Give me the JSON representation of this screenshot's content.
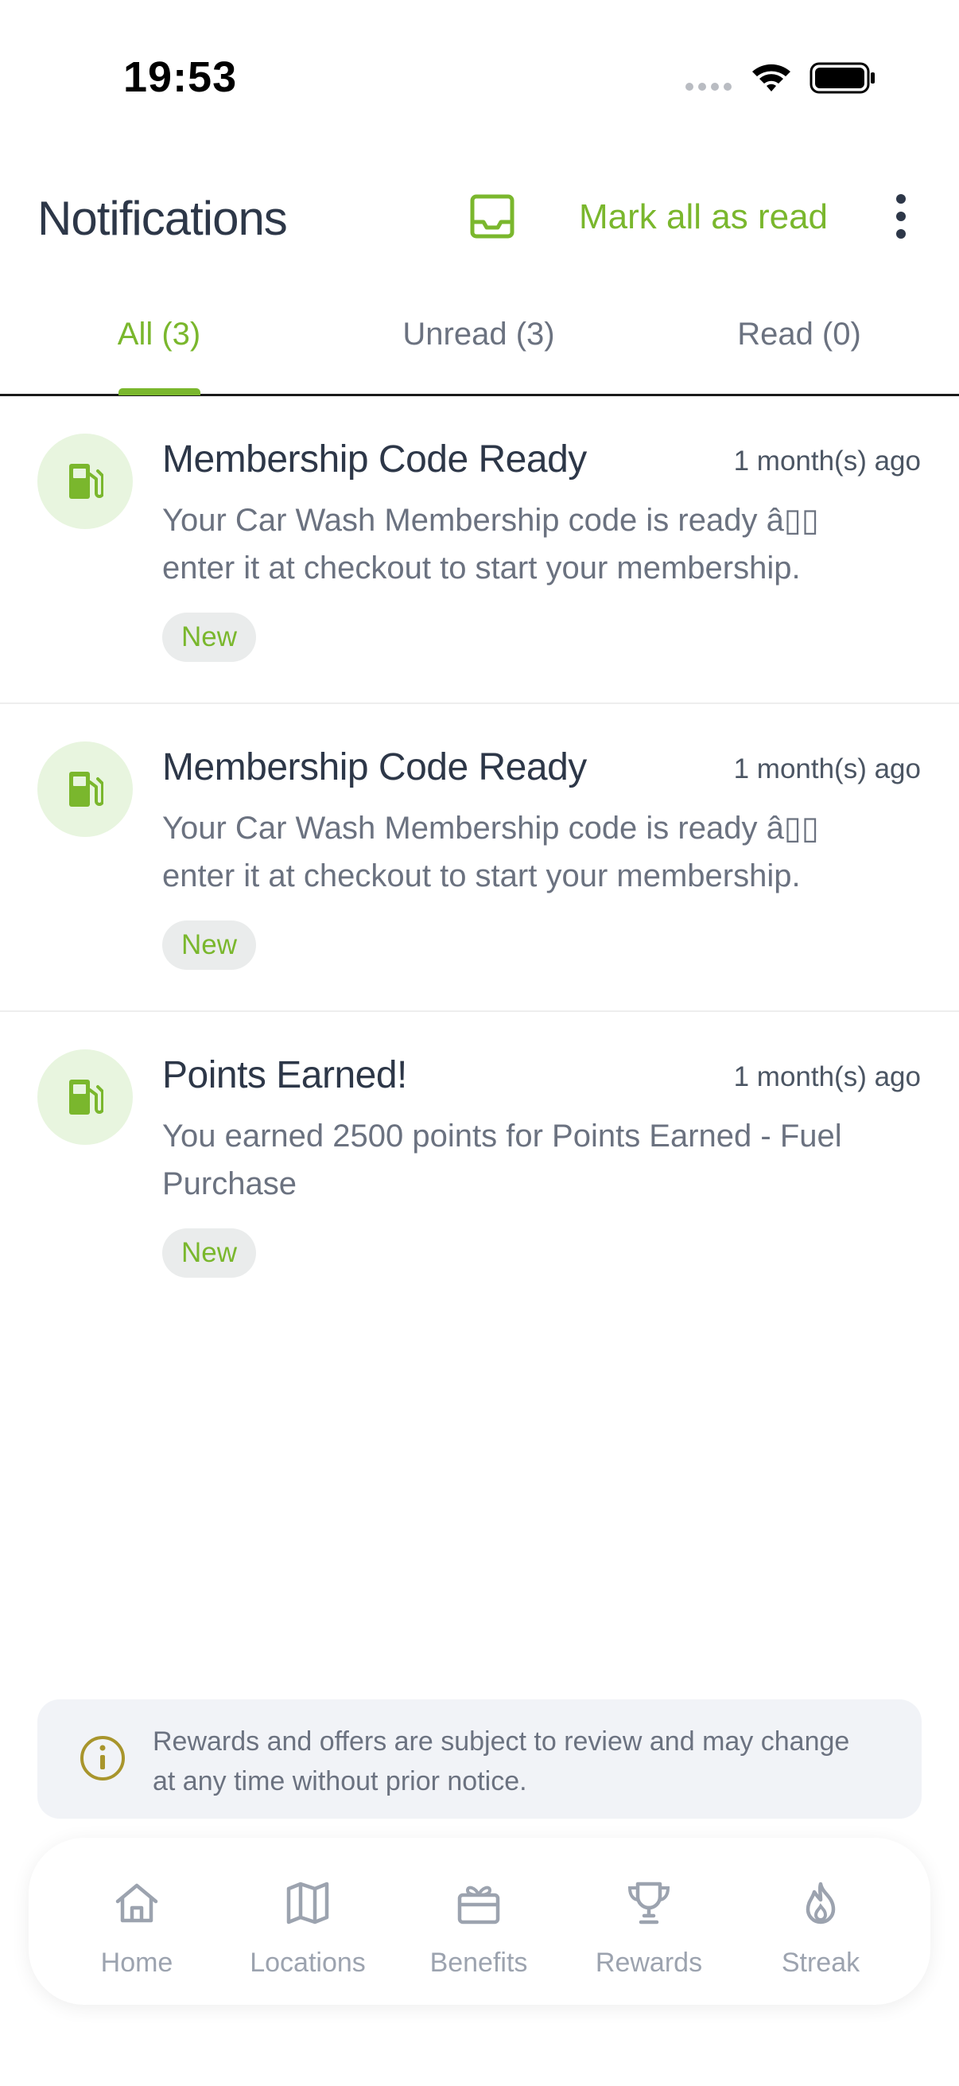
{
  "status_bar": {
    "time": "19:53"
  },
  "header": {
    "title": "Notifications",
    "inbox_icon": "inbox-icon",
    "mark_all_label": "Mark all as read",
    "more_icon": "more-vertical-icon"
  },
  "tabs": [
    {
      "label": "All (3)",
      "active": true
    },
    {
      "label": "Unread (3)",
      "active": false
    },
    {
      "label": "Read (0)",
      "active": false
    }
  ],
  "notifications": [
    {
      "icon": "fuel-pump-icon",
      "title": "Membership Code Ready",
      "time": "1 month(s) ago",
      "body": "Your Car Wash Membership code is ready â▯▯ enter it at checkout to start your membership.",
      "badge": "New"
    },
    {
      "icon": "fuel-pump-icon",
      "title": "Membership Code Ready",
      "time": "1 month(s) ago",
      "body": "Your Car Wash Membership code is ready â▯▯ enter it at checkout to start your membership.",
      "badge": "New"
    },
    {
      "icon": "fuel-pump-icon",
      "title": "Points Earned!",
      "time": "1 month(s) ago",
      "body": "You earned 2500 points for Points Earned - Fuel Purchase",
      "badge": "New"
    }
  ],
  "disclaimer": {
    "icon": "info-icon",
    "text": "Rewards and offers are subject to review and may change at any time without prior notice."
  },
  "bottom_nav": [
    {
      "label": "Home",
      "icon": "home-icon"
    },
    {
      "label": "Locations",
      "icon": "map-icon"
    },
    {
      "label": "Benefits",
      "icon": "gift-icon"
    },
    {
      "label": "Rewards",
      "icon": "trophy-icon"
    },
    {
      "label": "Streak",
      "icon": "flame-icon"
    }
  ],
  "colors": {
    "accent": "#7ab72d",
    "text_primary": "#2d3748",
    "text_secondary": "#6b7280",
    "badge_bg": "#eaecec",
    "avatar_bg": "#e8f5df",
    "disclaimer_bg": "#f1f3f7"
  }
}
